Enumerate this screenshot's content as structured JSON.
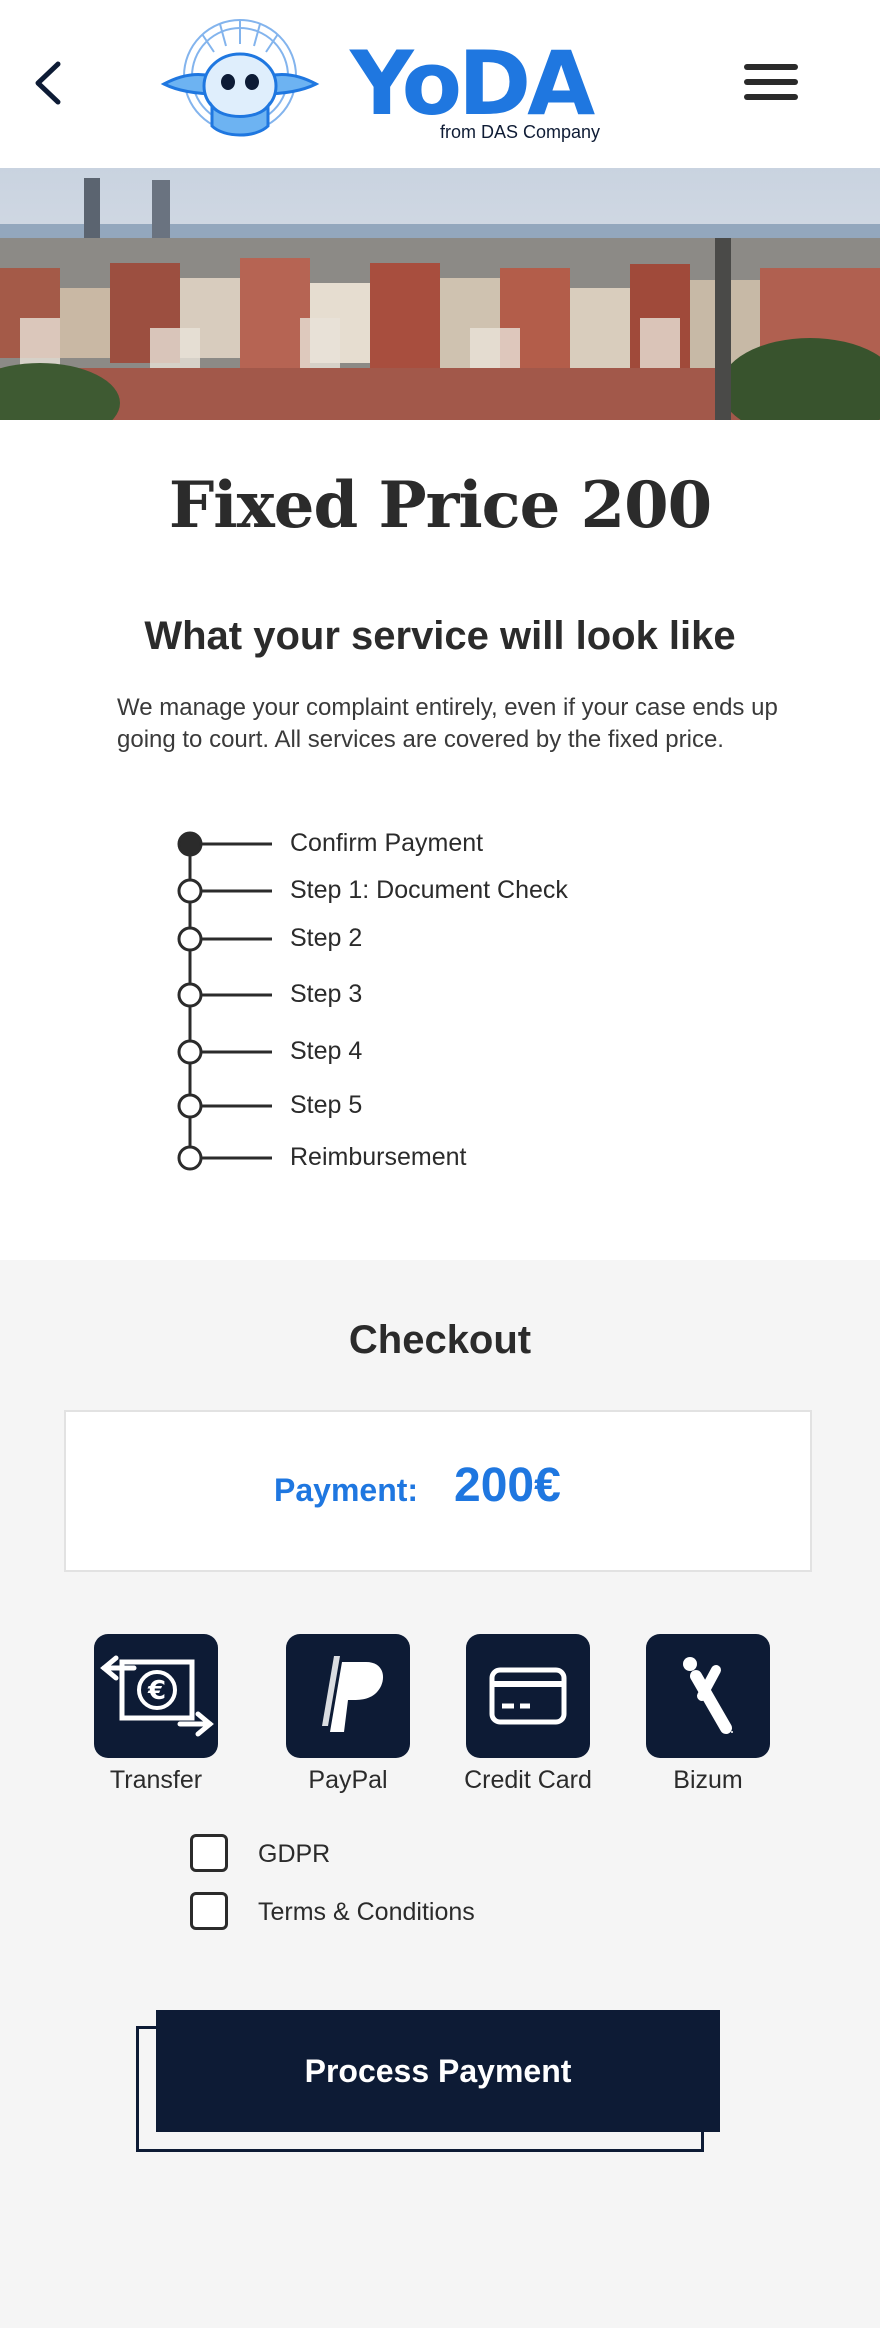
{
  "header": {
    "back_icon": "chevron-left-icon",
    "logo_text": "YoDA",
    "logo_subtext": "from DAS Company",
    "menu_icon": "hamburger-menu-icon"
  },
  "hero": {
    "description": "city skyline"
  },
  "main": {
    "title": "Fixed Price 200",
    "subtitle": "What your service will look like",
    "description": "We manage your complaint entirely, even if your case ends up going to court. All services are covered by the fixed price.",
    "steps": [
      {
        "label": "Confirm Payment",
        "completed": true
      },
      {
        "label": "Step 1: Document Check",
        "completed": false
      },
      {
        "label": "Step 2",
        "completed": false
      },
      {
        "label": "Step 3",
        "completed": false
      },
      {
        "label": "Step 4",
        "completed": false
      },
      {
        "label": "Step 5",
        "completed": false
      },
      {
        "label": "Reimbursement",
        "completed": false
      }
    ]
  },
  "checkout": {
    "title": "Checkout",
    "payment_label": "Payment:",
    "payment_amount": "200€",
    "methods": [
      {
        "label": "Transfer",
        "icon": "bank-transfer-icon"
      },
      {
        "label": "PayPal",
        "icon": "paypal-icon"
      },
      {
        "label": "Credit Card",
        "icon": "credit-card-icon"
      },
      {
        "label": "Bizum",
        "icon": "bizum-icon"
      }
    ],
    "checkboxes": [
      {
        "label": "GDPR",
        "checked": false
      },
      {
        "label": "Terms & Conditions",
        "checked": false
      }
    ],
    "submit_label": "Process Payment"
  },
  "colors": {
    "brand_blue": "#1f77e0",
    "navy": "#0d1b35",
    "background_gray": "#f5f5f5"
  }
}
